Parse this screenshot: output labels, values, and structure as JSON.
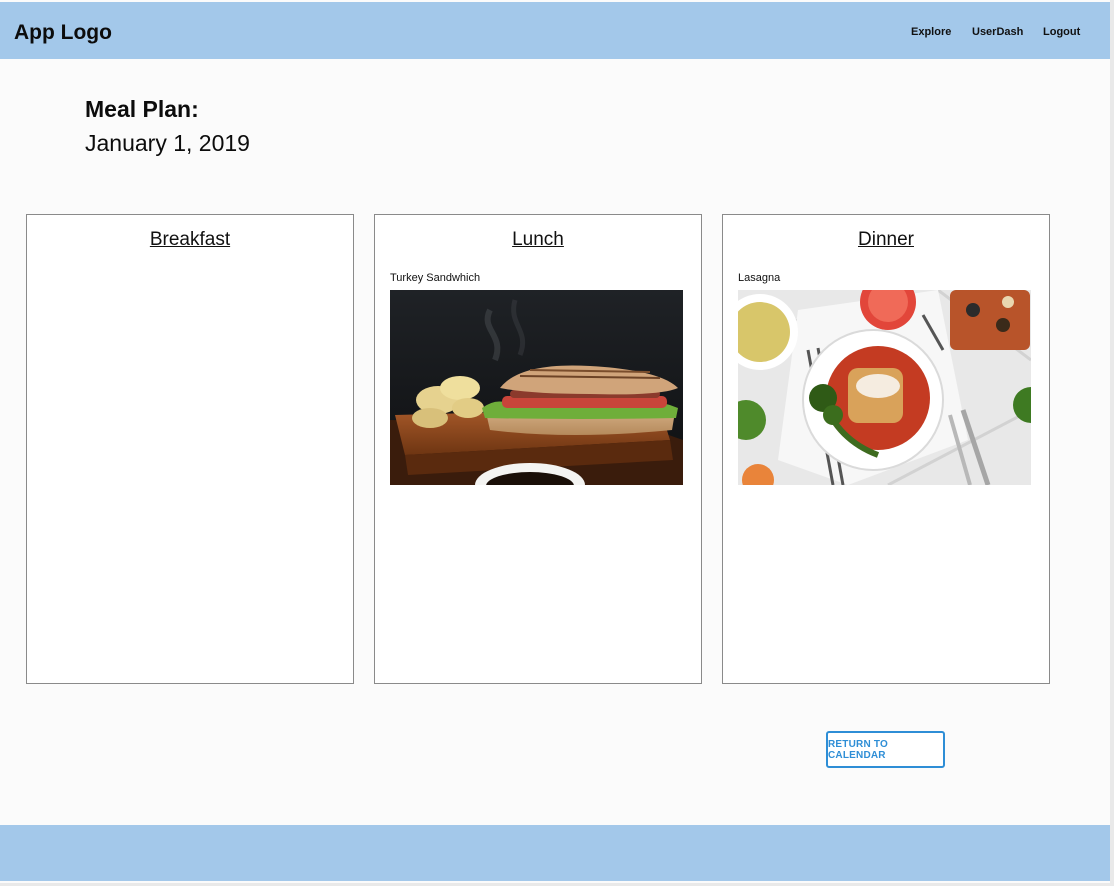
{
  "header": {
    "logo": "App Logo",
    "nav": [
      "Explore",
      "UserDash",
      "Logout"
    ]
  },
  "meal_plan": {
    "title": "Meal Plan:",
    "date": "January 1, 2019"
  },
  "meals": {
    "breakfast": {
      "label": "Breakfast"
    },
    "lunch": {
      "label": "Lunch",
      "item": "Turkey Sandwhich",
      "image": "turkey-sandwich-photo"
    },
    "dinner": {
      "label": "Dinner",
      "item": "Lasagna",
      "image": "lasagna-photo"
    }
  },
  "actions": {
    "return_label": "RETURN TO CALENDAR"
  },
  "colors": {
    "header_bg": "#a3c8ea",
    "accent": "#2e8ed6"
  }
}
